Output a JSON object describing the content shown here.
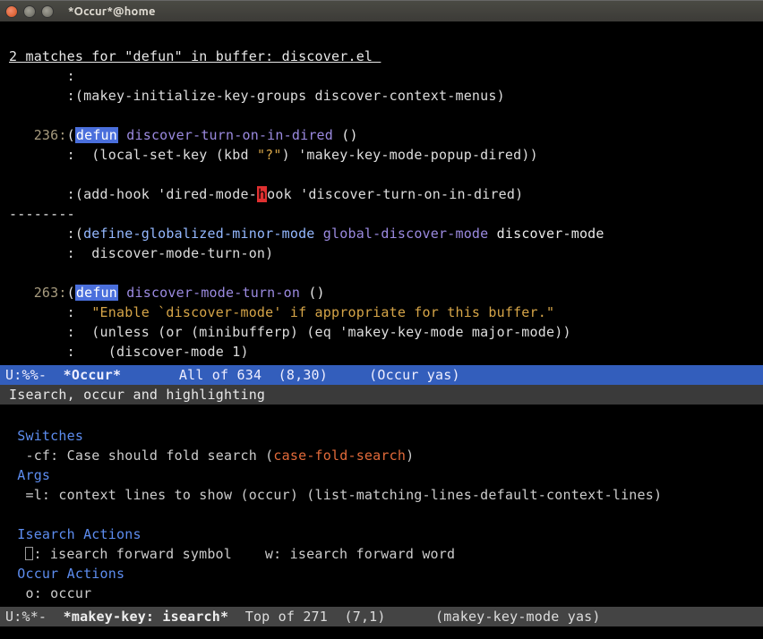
{
  "window": {
    "title": "*Occur*@home"
  },
  "occur": {
    "header": "2 matches for \"defun\" in buffer: discover.el ",
    "l1a": "       :",
    "l1b": "       :(makey-initialize-key-groups discover-context-menus)",
    "blank1": "",
    "ln236": "   236:",
    "defun1": "defun",
    "fn1": " discover-turn-on-in-dired",
    "paren1": " ()",
    "l3a": "       :  (local-set-key (kbd ",
    "l3str": "\"?\"",
    "l3b": ") 'makey-key-mode-popup-dired))",
    "blank2": "",
    "l4a": "       :(add-hook 'dired-mode-",
    "cursor": "h",
    "l4b": "ook 'discover-turn-on-in-dired)",
    "dashes": "--------",
    "l5a": "       :(",
    "l5kw": "define-globalized-minor-mode",
    "l5fn": " global-discover-mode",
    "l5b": " discover-mode",
    "l6": "       :  discover-mode-turn-on)",
    "blank3": "",
    "ln263": "   263:",
    "defun2": "defun",
    "fn2": " discover-mode-turn-on",
    "paren2": " ()",
    "l8a": "       :  ",
    "l8str": "\"Enable `discover-mode' if appropriate for this buffer.\"",
    "l9": "       :  (unless (or (minibufferp) (eq 'makey-key-mode major-mode))",
    "l10": "       :    (discover-mode 1)"
  },
  "modeline1": {
    "left": "U:%%-  ",
    "name": "*Occur*",
    "mid": "       All of 634  (8,30)     (Occur yas)"
  },
  "help": {
    "title": "Isearch, occur and highlighting",
    "switches": " Switches",
    "sw1a": "  -cf: Case should fold search (",
    "sw1b": "case-fold-search",
    "sw1c": ")",
    "args": " Args",
    "ar1": "  =l: context lines to show (occur) (list-matching-lines-default-context-lines)",
    "blank": "",
    "iact": " Isearch Actions",
    "ia1a": "  ",
    "ia1b": ": isearch forward symbol    w: isearch forward word",
    "oact": " Occur Actions",
    "oa1": "  o: occur"
  },
  "modeline2": {
    "left": "U:%*-  ",
    "name": "*makey-key: isearch*",
    "mid": "  Top of 271  (7,1)      (makey-key-mode yas)"
  }
}
